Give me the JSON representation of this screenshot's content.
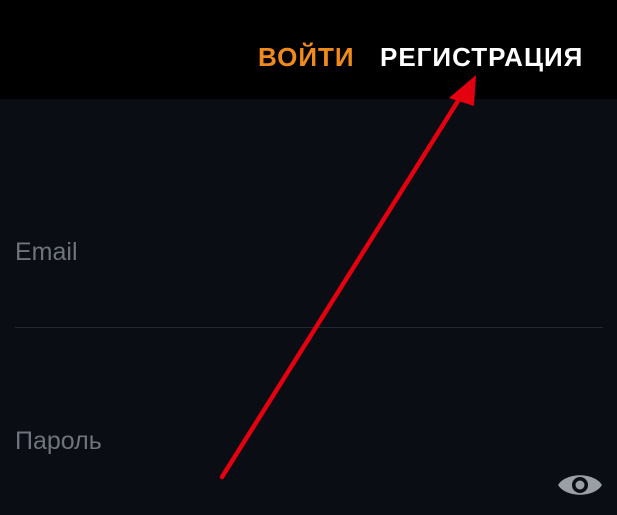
{
  "header": {
    "login_tab": "ВОЙТИ",
    "register_tab": "РЕГИСТРАЦИЯ"
  },
  "form": {
    "email": {
      "placeholder": "Email",
      "value": ""
    },
    "password": {
      "placeholder": "Пароль",
      "value": ""
    },
    "password_toggle_icon": "eye-icon"
  },
  "colors": {
    "background": "#0a0d13",
    "header_background": "#000000",
    "active_tab": "#f08a1c",
    "inactive_tab": "#ffffff",
    "placeholder": "#6e737c",
    "divider": "#232833",
    "annotation_arrow": "#e3000f",
    "icon": "#9a9ea5"
  },
  "annotation": {
    "type": "arrow",
    "points_to": "register-tab"
  }
}
